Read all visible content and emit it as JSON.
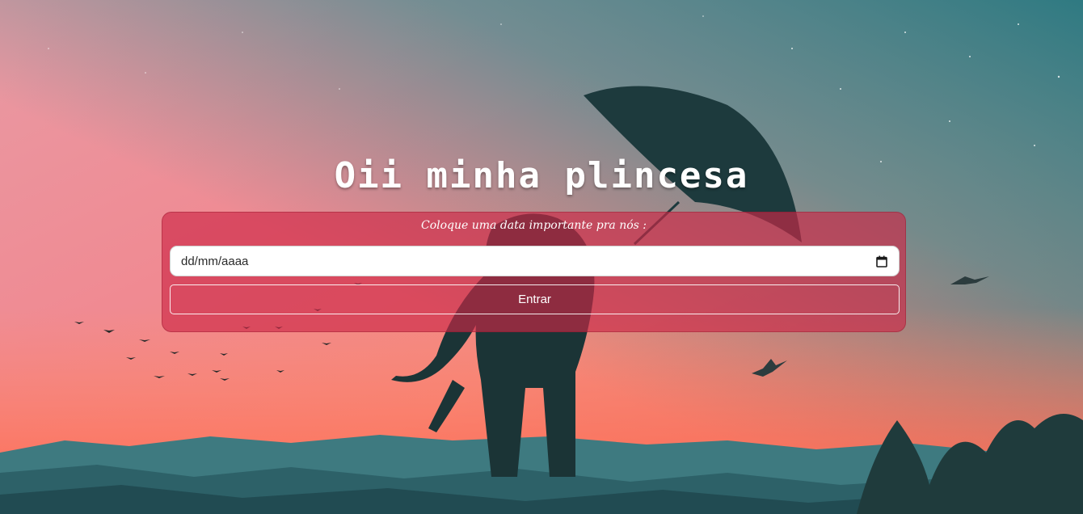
{
  "page": {
    "title": "Oii minha plincesa"
  },
  "form": {
    "prompt": "Coloque uma data importante pra nós :",
    "date_input": {
      "value": "dd/mm/aaaa",
      "icon": "calendar-icon"
    },
    "submit_label": "Entrar"
  },
  "colors": {
    "card_background": "#cd2846",
    "button_border": "#ffffff",
    "text": "#ffffff"
  }
}
